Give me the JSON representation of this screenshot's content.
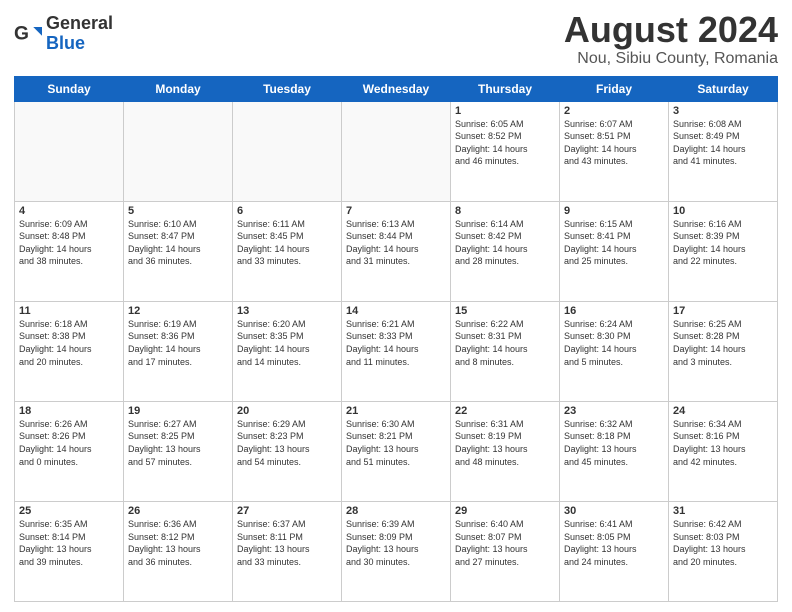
{
  "header": {
    "logo_general": "General",
    "logo_blue": "Blue",
    "main_title": "August 2024",
    "subtitle": "Nou, Sibiu County, Romania"
  },
  "days_of_week": [
    "Sunday",
    "Monday",
    "Tuesday",
    "Wednesday",
    "Thursday",
    "Friday",
    "Saturday"
  ],
  "weeks": [
    [
      {
        "day": "",
        "info": ""
      },
      {
        "day": "",
        "info": ""
      },
      {
        "day": "",
        "info": ""
      },
      {
        "day": "",
        "info": ""
      },
      {
        "day": "1",
        "info": "Sunrise: 6:05 AM\nSunset: 8:52 PM\nDaylight: 14 hours\nand 46 minutes."
      },
      {
        "day": "2",
        "info": "Sunrise: 6:07 AM\nSunset: 8:51 PM\nDaylight: 14 hours\nand 43 minutes."
      },
      {
        "day": "3",
        "info": "Sunrise: 6:08 AM\nSunset: 8:49 PM\nDaylight: 14 hours\nand 41 minutes."
      }
    ],
    [
      {
        "day": "4",
        "info": "Sunrise: 6:09 AM\nSunset: 8:48 PM\nDaylight: 14 hours\nand 38 minutes."
      },
      {
        "day": "5",
        "info": "Sunrise: 6:10 AM\nSunset: 8:47 PM\nDaylight: 14 hours\nand 36 minutes."
      },
      {
        "day": "6",
        "info": "Sunrise: 6:11 AM\nSunset: 8:45 PM\nDaylight: 14 hours\nand 33 minutes."
      },
      {
        "day": "7",
        "info": "Sunrise: 6:13 AM\nSunset: 8:44 PM\nDaylight: 14 hours\nand 31 minutes."
      },
      {
        "day": "8",
        "info": "Sunrise: 6:14 AM\nSunset: 8:42 PM\nDaylight: 14 hours\nand 28 minutes."
      },
      {
        "day": "9",
        "info": "Sunrise: 6:15 AM\nSunset: 8:41 PM\nDaylight: 14 hours\nand 25 minutes."
      },
      {
        "day": "10",
        "info": "Sunrise: 6:16 AM\nSunset: 8:39 PM\nDaylight: 14 hours\nand 22 minutes."
      }
    ],
    [
      {
        "day": "11",
        "info": "Sunrise: 6:18 AM\nSunset: 8:38 PM\nDaylight: 14 hours\nand 20 minutes."
      },
      {
        "day": "12",
        "info": "Sunrise: 6:19 AM\nSunset: 8:36 PM\nDaylight: 14 hours\nand 17 minutes."
      },
      {
        "day": "13",
        "info": "Sunrise: 6:20 AM\nSunset: 8:35 PM\nDaylight: 14 hours\nand 14 minutes."
      },
      {
        "day": "14",
        "info": "Sunrise: 6:21 AM\nSunset: 8:33 PM\nDaylight: 14 hours\nand 11 minutes."
      },
      {
        "day": "15",
        "info": "Sunrise: 6:22 AM\nSunset: 8:31 PM\nDaylight: 14 hours\nand 8 minutes."
      },
      {
        "day": "16",
        "info": "Sunrise: 6:24 AM\nSunset: 8:30 PM\nDaylight: 14 hours\nand 5 minutes."
      },
      {
        "day": "17",
        "info": "Sunrise: 6:25 AM\nSunset: 8:28 PM\nDaylight: 14 hours\nand 3 minutes."
      }
    ],
    [
      {
        "day": "18",
        "info": "Sunrise: 6:26 AM\nSunset: 8:26 PM\nDaylight: 14 hours\nand 0 minutes."
      },
      {
        "day": "19",
        "info": "Sunrise: 6:27 AM\nSunset: 8:25 PM\nDaylight: 13 hours\nand 57 minutes."
      },
      {
        "day": "20",
        "info": "Sunrise: 6:29 AM\nSunset: 8:23 PM\nDaylight: 13 hours\nand 54 minutes."
      },
      {
        "day": "21",
        "info": "Sunrise: 6:30 AM\nSunset: 8:21 PM\nDaylight: 13 hours\nand 51 minutes."
      },
      {
        "day": "22",
        "info": "Sunrise: 6:31 AM\nSunset: 8:19 PM\nDaylight: 13 hours\nand 48 minutes."
      },
      {
        "day": "23",
        "info": "Sunrise: 6:32 AM\nSunset: 8:18 PM\nDaylight: 13 hours\nand 45 minutes."
      },
      {
        "day": "24",
        "info": "Sunrise: 6:34 AM\nSunset: 8:16 PM\nDaylight: 13 hours\nand 42 minutes."
      }
    ],
    [
      {
        "day": "25",
        "info": "Sunrise: 6:35 AM\nSunset: 8:14 PM\nDaylight: 13 hours\nand 39 minutes."
      },
      {
        "day": "26",
        "info": "Sunrise: 6:36 AM\nSunset: 8:12 PM\nDaylight: 13 hours\nand 36 minutes."
      },
      {
        "day": "27",
        "info": "Sunrise: 6:37 AM\nSunset: 8:11 PM\nDaylight: 13 hours\nand 33 minutes."
      },
      {
        "day": "28",
        "info": "Sunrise: 6:39 AM\nSunset: 8:09 PM\nDaylight: 13 hours\nand 30 minutes."
      },
      {
        "day": "29",
        "info": "Sunrise: 6:40 AM\nSunset: 8:07 PM\nDaylight: 13 hours\nand 27 minutes."
      },
      {
        "day": "30",
        "info": "Sunrise: 6:41 AM\nSunset: 8:05 PM\nDaylight: 13 hours\nand 24 minutes."
      },
      {
        "day": "31",
        "info": "Sunrise: 6:42 AM\nSunset: 8:03 PM\nDaylight: 13 hours\nand 20 minutes."
      }
    ]
  ]
}
